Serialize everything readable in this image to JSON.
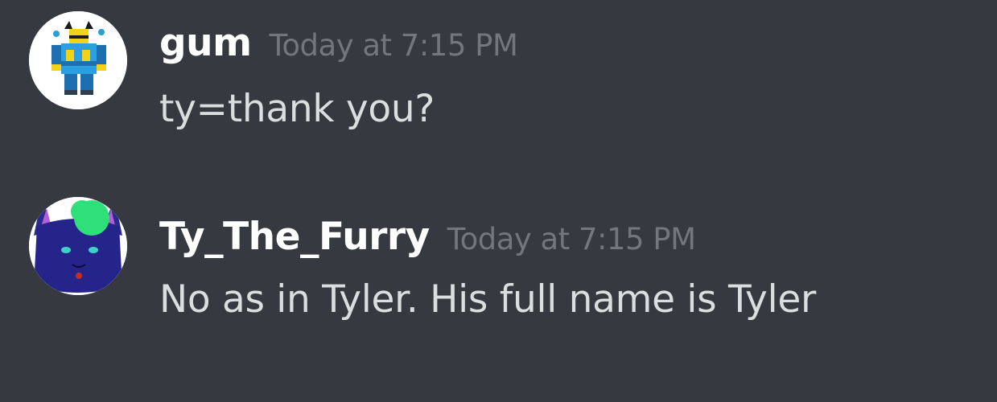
{
  "messages": [
    {
      "username": "gum",
      "timestamp": "Today at 7:15 PM",
      "content": "ty=thank you?",
      "avatar_icon": "roblox-character-avatar"
    },
    {
      "username": "Ty_The_Furry",
      "timestamp": "Today at 7:15 PM",
      "content": "No as in Tyler. His full name is Tyler",
      "avatar_icon": "blue-wolf-avatar"
    }
  ],
  "colors": {
    "background": "#36393f",
    "username": "#ffffff",
    "timestamp": "#72767d",
    "content": "#dcddde"
  }
}
